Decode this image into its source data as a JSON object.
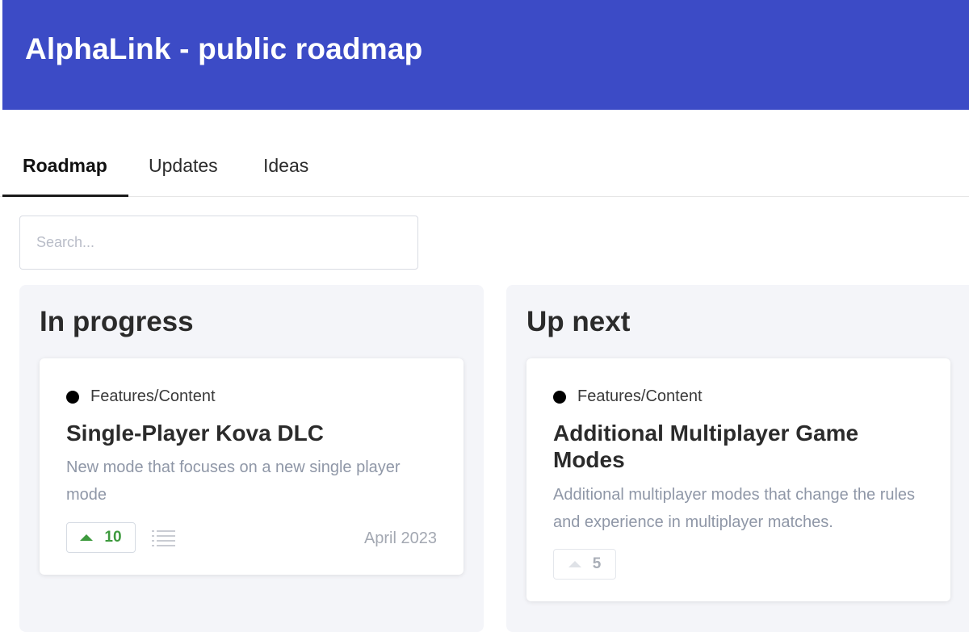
{
  "header": {
    "title": "AlphaLink - public roadmap",
    "background_color": "#3c4bc6"
  },
  "tabs": [
    {
      "label": "Roadmap",
      "active": true
    },
    {
      "label": "Updates",
      "active": false
    },
    {
      "label": "Ideas",
      "active": false
    }
  ],
  "search": {
    "placeholder": "Search...",
    "value": ""
  },
  "columns": [
    {
      "title": "In progress",
      "cards": [
        {
          "category": "Features/Content",
          "title": "Single-Player Kova DLC",
          "description": "New mode that focuses on a new single player mode",
          "votes": "10",
          "date": "April 2023",
          "icons": [
            "upvote-arrow-icon",
            "list-icon"
          ]
        }
      ]
    },
    {
      "title": "Up next",
      "cards": [
        {
          "category": "Features/Content",
          "title": "Additional Multiplayer Game Modes",
          "description": "Additional multiplayer modes that change the rules and experience in multiplayer matches.",
          "votes": "5",
          "icons": [
            "upvote-arrow-icon"
          ]
        }
      ]
    }
  ],
  "colors": {
    "accent": "#3c4bc6",
    "vote_active": "#3e9a3e",
    "category_dot": "#000000",
    "column_background": "#f4f5f9"
  }
}
